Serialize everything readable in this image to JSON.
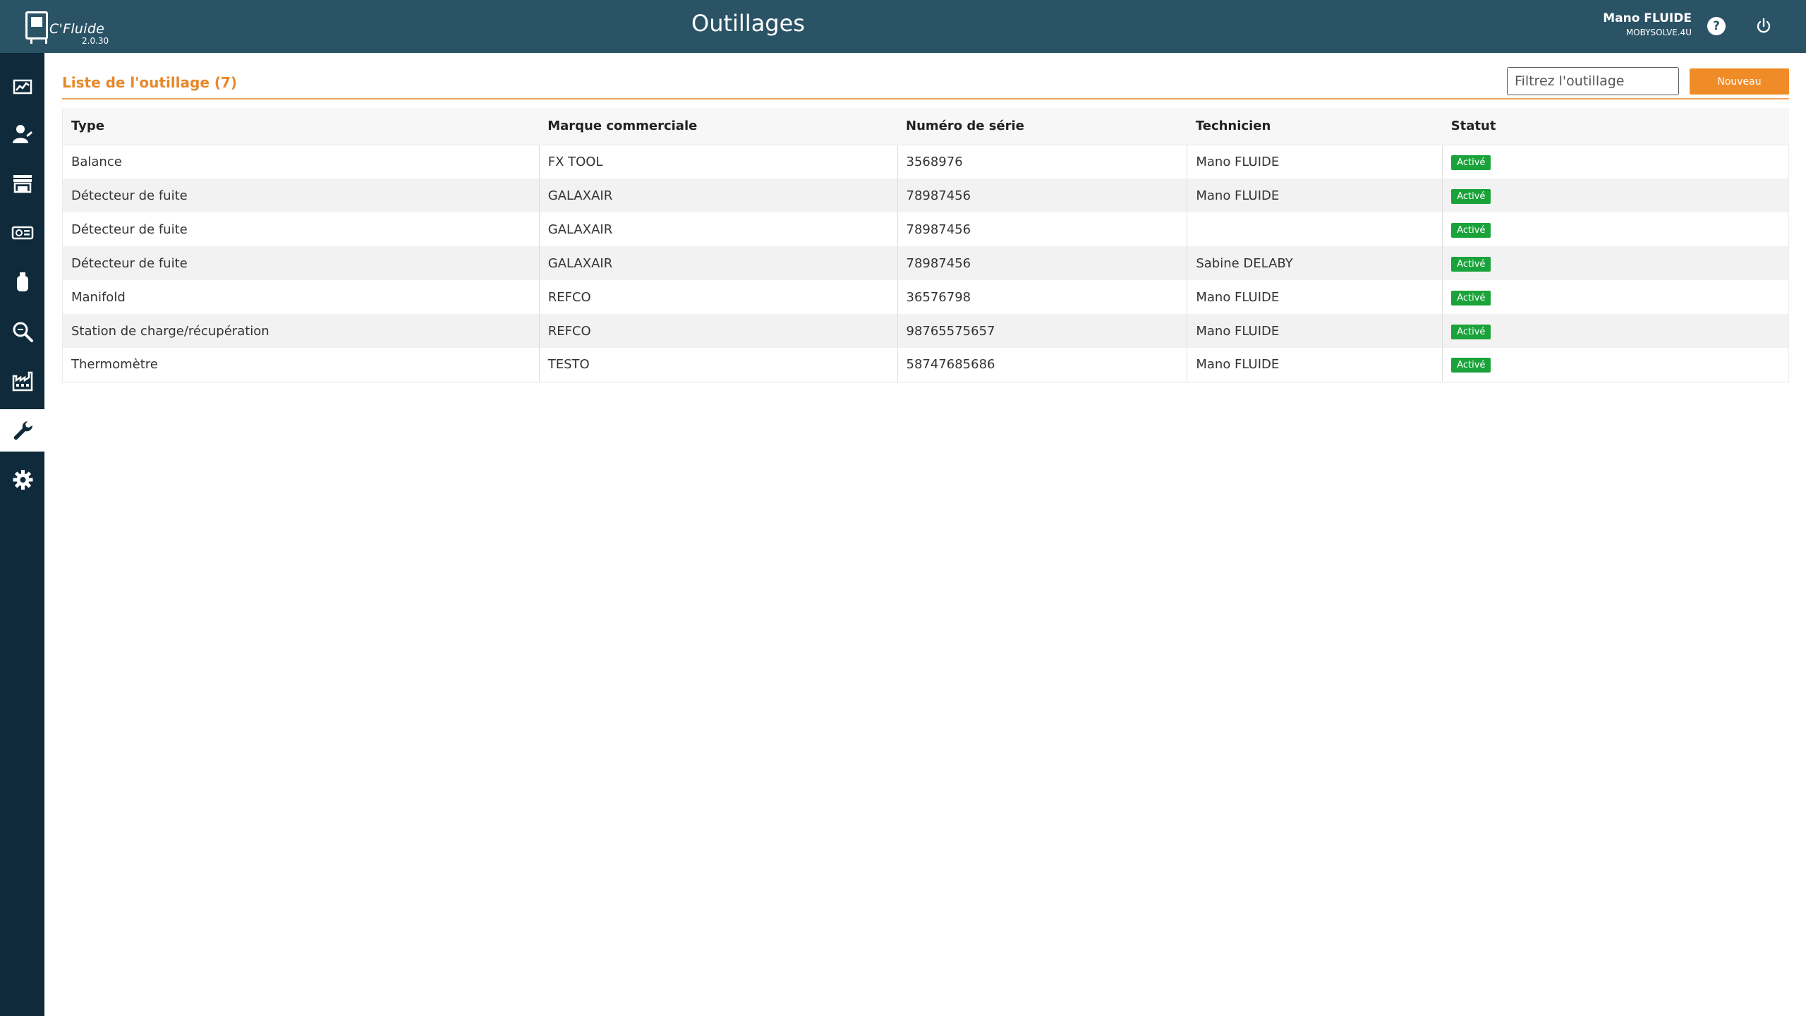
{
  "app": {
    "name": "C'Fluide",
    "version": "2.0.30"
  },
  "header": {
    "title": "Outillages",
    "user_name": "Mano FLUIDE",
    "user_org": "MOBYSOLVE.4U",
    "help_label": "?"
  },
  "sidebar": {
    "items": [
      {
        "icon": "dashboard-chart-icon"
      },
      {
        "icon": "technician-icon"
      },
      {
        "icon": "store-icon"
      },
      {
        "icon": "equipment-icon"
      },
      {
        "icon": "gas-bottle-icon"
      },
      {
        "icon": "search-icon"
      },
      {
        "icon": "factory-icon"
      },
      {
        "icon": "wrench-icon",
        "active": true
      },
      {
        "icon": "gear-icon"
      }
    ]
  },
  "main": {
    "list_title": "Liste de l'outillage (7)",
    "filter_placeholder": "Filtrez l'outillage",
    "new_button": "Nouveau",
    "columns": [
      "Type",
      "Marque commerciale",
      "Numéro de série",
      "Technicien",
      "Statut"
    ],
    "rows": [
      {
        "type": "Balance",
        "brand": "FX TOOL",
        "serial": "3568976",
        "technician": "Mano FLUIDE",
        "status": "Activé"
      },
      {
        "type": "Détecteur de fuite",
        "brand": "GALAXAIR",
        "serial": "78987456",
        "technician": "Mano FLUIDE",
        "status": "Activé"
      },
      {
        "type": "Détecteur de fuite",
        "brand": "GALAXAIR",
        "serial": "78987456",
        "technician": "",
        "status": "Activé"
      },
      {
        "type": "Détecteur de fuite",
        "brand": "GALAXAIR",
        "serial": "78987456",
        "technician": "Sabine DELABY",
        "status": "Activé"
      },
      {
        "type": "Manifold",
        "brand": "REFCO",
        "serial": "36576798",
        "technician": "Mano FLUIDE",
        "status": "Activé"
      },
      {
        "type": "Station de charge/récupération",
        "brand": "REFCO",
        "serial": "98765575657",
        "technician": "Mano FLUIDE",
        "status": "Activé"
      },
      {
        "type": "Thermomètre",
        "brand": "TESTO",
        "serial": "58747685686",
        "technician": "Mano FLUIDE",
        "status": "Activé"
      }
    ]
  },
  "colors": {
    "header_bg": "#2b5366",
    "sidebar_bg": "#0f2b3b",
    "accent_orange": "#f08c28",
    "status_green": "#1aa33a"
  }
}
